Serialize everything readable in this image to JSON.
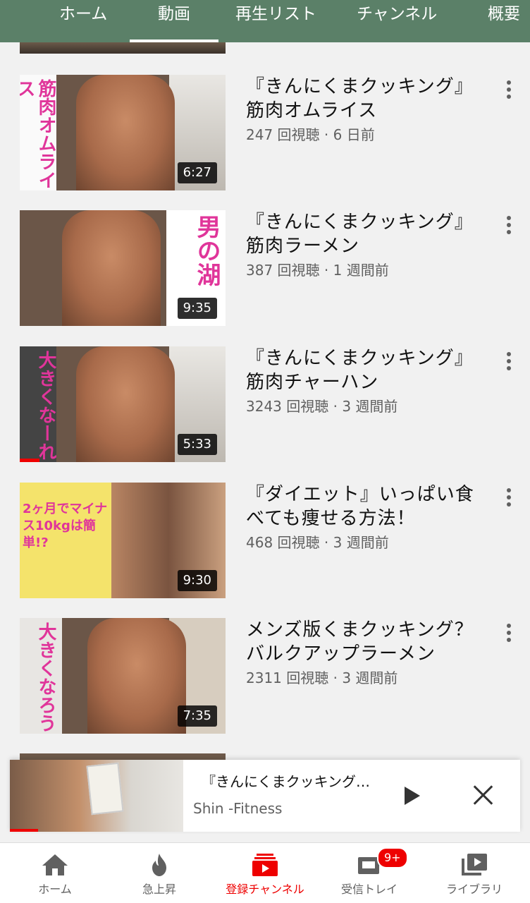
{
  "tabs": [
    {
      "label": "ホーム"
    },
    {
      "label": "動画"
    },
    {
      "label": "再生リスト"
    },
    {
      "label": "チャンネル"
    },
    {
      "label": "概要"
    }
  ],
  "videos": [
    {
      "title": "『きんにくまクッキング』筋肉オムライス",
      "views": "247 回視聴",
      "age": "6 日前",
      "duration": "6:27",
      "thumb_text": "筋肉オムライス"
    },
    {
      "title": "『きんにくまクッキング』筋肉ラーメン",
      "views": "387 回視聴",
      "age": "1 週間前",
      "duration": "9:35",
      "thumb_text": "男の湖"
    },
    {
      "title": "『きんにくまクッキング』筋肉チャーハン",
      "views": "3243 回視聴",
      "age": "3 週間前",
      "duration": "5:33",
      "thumb_text": "大きくなーれ"
    },
    {
      "title": "『ダイエット』いっぱい食べても痩せる方法！",
      "views": "468 回視聴",
      "age": "3 週間前",
      "duration": "9:30",
      "thumb_text": "2ヶ月でマイナス10kgは簡単!?"
    },
    {
      "title": "メンズ版くまクッキング？バルクアップラーメン",
      "views": "2311 回視聴",
      "age": "3 週間前",
      "duration": "7:35",
      "thumb_text": "大きくなろう"
    }
  ],
  "video_separator": "·",
  "mini_player": {
    "title": "『きんにくまクッキング…",
    "channel": "Shin -Fitness"
  },
  "bottom_nav": [
    {
      "label": "ホーム",
      "icon": "home-icon"
    },
    {
      "label": "急上昇",
      "icon": "flame-icon"
    },
    {
      "label": "登録チャンネル",
      "icon": "subscriptions-icon"
    },
    {
      "label": "受信トレイ",
      "icon": "inbox-icon",
      "badge": "9+"
    },
    {
      "label": "ライブラリ",
      "icon": "library-icon"
    }
  ],
  "colors": {
    "header": "#5b8068",
    "accent": "#ee0000"
  }
}
